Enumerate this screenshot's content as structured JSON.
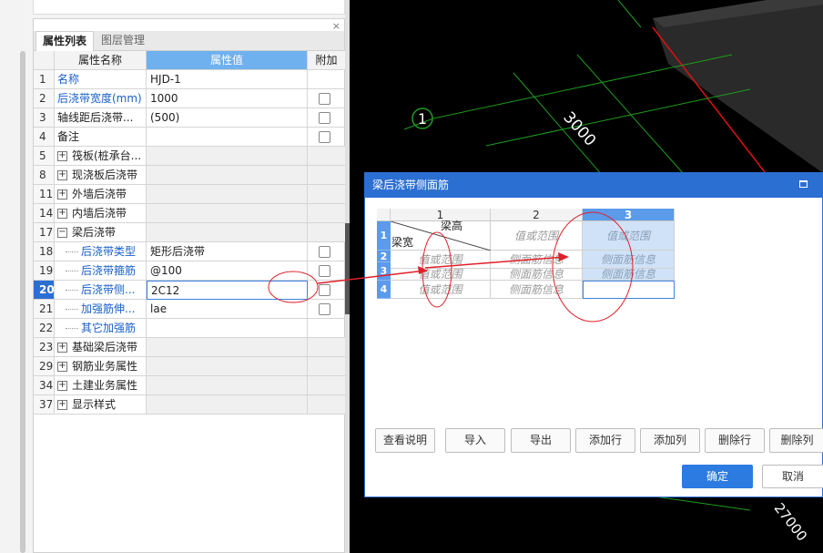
{
  "panel": {
    "close_glyph": "×",
    "tabs": [
      "属性列表",
      "图层管理"
    ],
    "headers": {
      "name": "属性名称",
      "value": "属性值",
      "add": "附加"
    }
  },
  "rows": [
    {
      "num": "1",
      "name": "名称",
      "value": "HJD-1",
      "name_blue": true,
      "checkbox": false,
      "gray": false,
      "indent": 0
    },
    {
      "num": "2",
      "name": "后浇带宽度(mm)",
      "value": "1000",
      "name_blue": true,
      "checkbox": true,
      "gray": false,
      "indent": 0
    },
    {
      "num": "3",
      "name": "轴线距后浇带...",
      "value": "(500)",
      "name_blue": false,
      "checkbox": true,
      "gray": false,
      "indent": 0
    },
    {
      "num": "4",
      "name": "备注",
      "value": "",
      "name_blue": false,
      "checkbox": true,
      "gray": false,
      "indent": 0
    },
    {
      "num": "5",
      "name": "筏板(桩承台...",
      "value": "",
      "name_blue": false,
      "checkbox": false,
      "gray": true,
      "indent": 0,
      "expand": "+"
    },
    {
      "num": "8",
      "name": "现浇板后浇带",
      "value": "",
      "name_blue": false,
      "checkbox": false,
      "gray": true,
      "indent": 0,
      "expand": "+"
    },
    {
      "num": "11",
      "name": "外墙后浇带",
      "value": "",
      "name_blue": false,
      "checkbox": false,
      "gray": true,
      "indent": 0,
      "expand": "+"
    },
    {
      "num": "14",
      "name": "内墙后浇带",
      "value": "",
      "name_blue": false,
      "checkbox": false,
      "gray": true,
      "indent": 0,
      "expand": "+"
    },
    {
      "num": "17",
      "name": "梁后浇带",
      "value": "",
      "name_blue": false,
      "checkbox": false,
      "gray": true,
      "indent": 0,
      "expand": "−"
    },
    {
      "num": "18",
      "name": "后浇带类型",
      "value": "矩形后浇带",
      "name_blue": true,
      "checkbox": true,
      "gray": false,
      "indent": 1
    },
    {
      "num": "19",
      "name": "后浇带箍筋",
      "value": "@100",
      "name_blue": true,
      "checkbox": true,
      "gray": false,
      "indent": 1
    },
    {
      "num": "20",
      "name": "后浇带侧...",
      "value": "2C12",
      "name_blue": true,
      "checkbox": true,
      "gray": false,
      "indent": 1,
      "selected": true
    },
    {
      "num": "21",
      "name": "加强筋伸...",
      "value": "lae",
      "name_blue": true,
      "checkbox": true,
      "gray": false,
      "indent": 1
    },
    {
      "num": "22",
      "name": "其它加强筋",
      "value": "",
      "name_blue": true,
      "checkbox": false,
      "gray": false,
      "indent": 1
    },
    {
      "num": "23",
      "name": "基础梁后浇带",
      "value": "",
      "name_blue": false,
      "checkbox": false,
      "gray": true,
      "indent": 0,
      "expand": "+"
    },
    {
      "num": "29",
      "name": "钢筋业务属性",
      "value": "",
      "name_blue": false,
      "checkbox": false,
      "gray": true,
      "indent": 0,
      "expand": "+"
    },
    {
      "num": "34",
      "name": "土建业务属性",
      "value": "",
      "name_blue": false,
      "checkbox": false,
      "gray": true,
      "indent": 0,
      "expand": "+"
    },
    {
      "num": "37",
      "name": "显示样式",
      "value": "",
      "name_blue": false,
      "checkbox": false,
      "gray": true,
      "indent": 0,
      "expand": "+"
    }
  ],
  "dots_label": "···",
  "cad": {
    "axis_label": "1",
    "dim1": "3000",
    "dim2": "27000",
    "colors": {
      "grid_line": "#1e9b1e",
      "red_line": "#e01010",
      "block": "#2a2a2a"
    }
  },
  "dialog": {
    "title": "梁后浇带侧面筋",
    "col_headers": [
      "1",
      "2",
      "3"
    ],
    "header_top": "梁高",
    "header_bottom": "梁宽",
    "row_nums": [
      "1",
      "2",
      "3",
      "4"
    ],
    "cells": [
      [
        "",
        "值或范围",
        "值或范围"
      ],
      [
        "值或范围",
        "侧面筋信息",
        "侧面筋信息"
      ],
      [
        "值或范围",
        "侧面筋信息",
        "侧面筋信息"
      ],
      [
        "值或范围",
        "侧面筋信息",
        ""
      ]
    ],
    "buttons": [
      "查看说明",
      "导入",
      "导出",
      "添加行",
      "添加列",
      "删除行",
      "删除列"
    ],
    "ok": "确定",
    "cancel": "取消"
  }
}
